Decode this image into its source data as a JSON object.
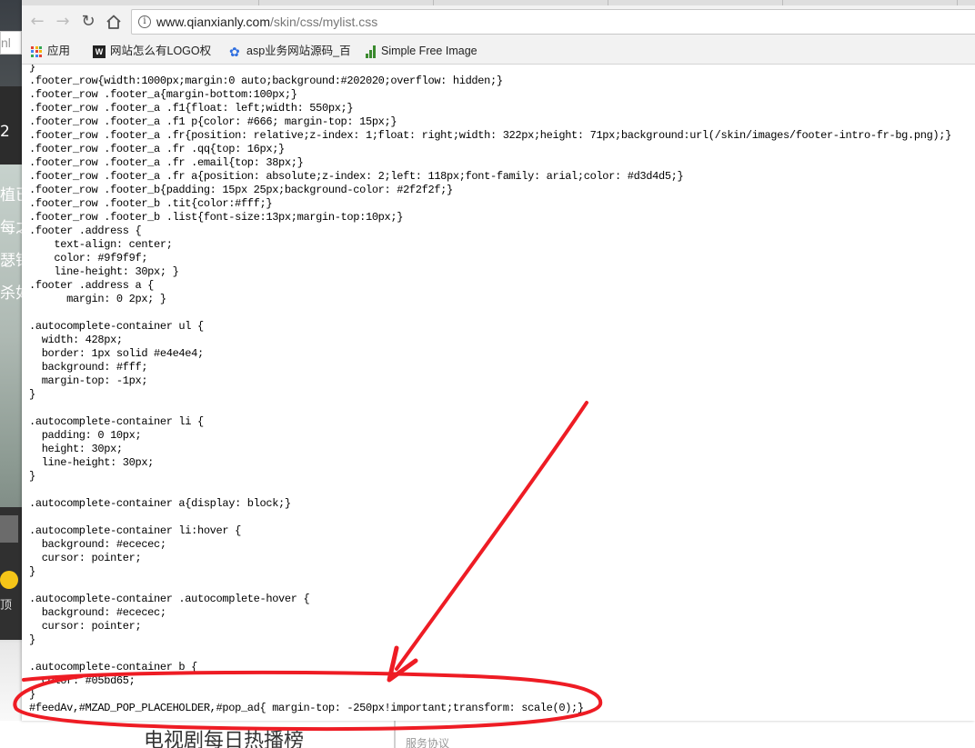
{
  "background": {
    "left_fragments": [
      "nl",
      "2",
      "植已",
      "每之",
      "瑟镇",
      "杀如",
      "顶"
    ],
    "bottom_title": "电视剧每日热播榜",
    "bottom_side": "服务协议"
  },
  "browser": {
    "nav": {
      "back_icon": "arrow-left-icon",
      "forward_icon": "arrow-right-icon",
      "reload_icon": "reload-icon",
      "home_icon": "home-icon"
    },
    "address": {
      "domain": "www.qianxianly.com",
      "path": "/skin/css/mylist.css"
    },
    "bookmarks": [
      {
        "label": "应用",
        "icon": "apps-grid-icon"
      },
      {
        "label": "网站怎么有LOGO权",
        "icon": "document-icon"
      },
      {
        "label": "asp业务网站源码_百",
        "icon": "baidu-paw-icon"
      },
      {
        "label": "Simple Free Image",
        "icon": "signal-bars-icon"
      }
    ]
  },
  "css_source": [
    "}",
    ".footer_row{width:1000px;margin:0 auto;background:#202020;overflow: hidden;}",
    ".footer_row .footer_a{margin-bottom:100px;}",
    ".footer_row .footer_a .f1{float: left;width: 550px;}",
    ".footer_row .footer_a .f1 p{color: #666; margin-top: 15px;}",
    ".footer_row .footer_a .fr{position: relative;z-index: 1;float: right;width: 322px;height: 71px;background:url(/skin/images/footer-intro-fr-bg.png);}",
    ".footer_row .footer_a .fr .qq{top: 16px;}",
    ".footer_row .footer_a .fr .email{top: 38px;}",
    ".footer_row .footer_a .fr a{position: absolute;z-index: 2;left: 118px;font-family: arial;color: #d3d4d5;}",
    ".footer_row .footer_b{padding: 15px 25px;background-color: #2f2f2f;}",
    ".footer_row .footer_b .tit{color:#fff;}",
    ".footer_row .footer_b .list{font-size:13px;margin-top:10px;}",
    ".footer .address {",
    "    text-align: center;",
    "    color: #9f9f9f;",
    "    line-height: 30px; }",
    ".footer .address a {",
    "      margin: 0 2px; }",
    "",
    ".autocomplete-container ul {",
    "  width: 428px;",
    "  border: 1px solid #e4e4e4;",
    "  background: #fff;",
    "  margin-top: -1px;",
    "}",
    "",
    ".autocomplete-container li {",
    "  padding: 0 10px;",
    "  height: 30px;",
    "  line-height: 30px;",
    "}",
    "",
    ".autocomplete-container a{display: block;}",
    "",
    ".autocomplete-container li:hover {",
    "  background: #ececec;",
    "  cursor: pointer;",
    "}",
    "",
    ".autocomplete-container .autocomplete-hover {",
    "  background: #ececec;",
    "  cursor: pointer;",
    "}",
    "",
    ".autocomplete-container b {",
    "  color: #05bd65;",
    "}",
    "#feedAv,#MZAD_POP_PLACEHOLDER,#pop_ad{ margin-top: -250px!important;transform: scale(0);}"
  ],
  "annotation": {
    "color": "#ee1c24",
    "shapes": [
      "red-arrow",
      "red-ellipse"
    ]
  }
}
